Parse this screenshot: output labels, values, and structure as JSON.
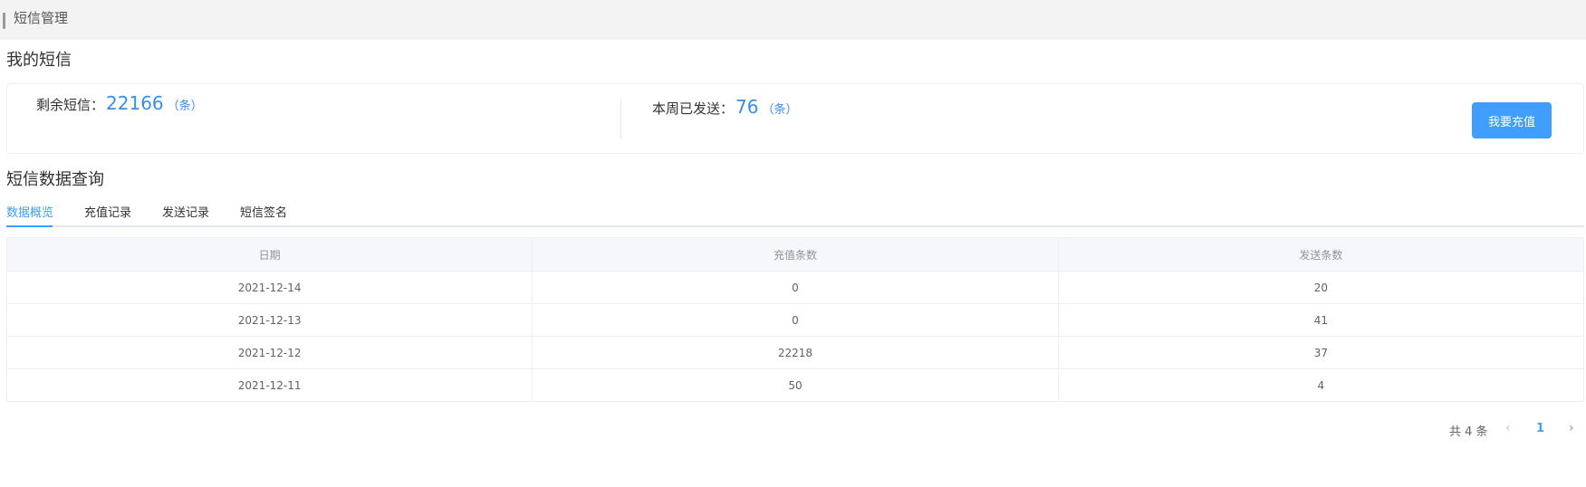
{
  "header": {
    "title": "短信管理"
  },
  "my_sms": {
    "title": "我的短信",
    "remaining_label": "剩余短信：",
    "remaining_value": "22166",
    "remaining_unit": "（条）",
    "weekly_label": "本周已发送：",
    "weekly_value": "76",
    "weekly_unit": "（条）",
    "recharge_button": "我要充值"
  },
  "query": {
    "title": "短信数据查询",
    "tabs": [
      {
        "label": "数据概览",
        "active": true
      },
      {
        "label": "充值记录",
        "active": false
      },
      {
        "label": "发送记录",
        "active": false
      },
      {
        "label": "短信签名",
        "active": false
      }
    ]
  },
  "table": {
    "columns": [
      "日期",
      "充值条数",
      "发送条数"
    ],
    "rows": [
      [
        "2021-12-14",
        "0",
        "20"
      ],
      [
        "2021-12-13",
        "0",
        "41"
      ],
      [
        "2021-12-12",
        "22218",
        "37"
      ],
      [
        "2021-12-11",
        "50",
        "4"
      ]
    ]
  },
  "pagination": {
    "total_text": "共 4 条",
    "prev_icon": "‹",
    "current_page": "1",
    "next_icon": "›"
  },
  "colors": {
    "accent": "#409eff",
    "value_blue": "#3a8ee6",
    "header_bg": "#f3f3f3",
    "table_header_bg": "#f5f7fa",
    "border": "#ebeef5"
  }
}
